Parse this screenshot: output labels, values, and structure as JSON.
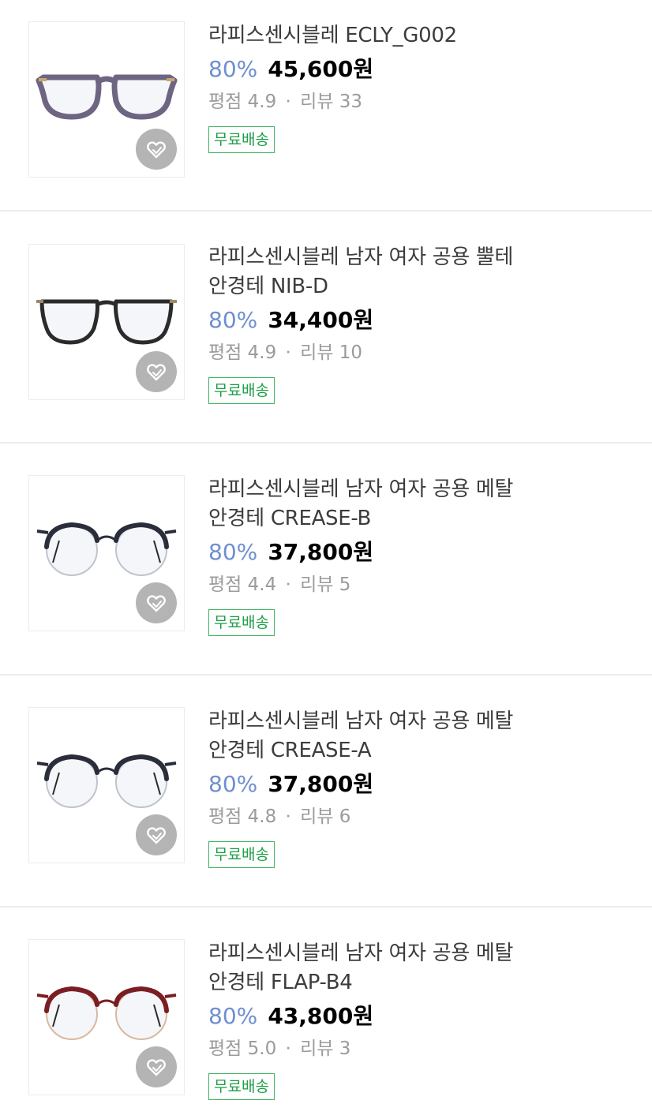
{
  "products": [
    {
      "title_line1": "라피스센시블레 ECLY_G002",
      "title_line2": "",
      "discount": "80%",
      "price": "45,600원",
      "rating_label": "평점",
      "rating": "4.9",
      "review_label": "리뷰",
      "reviews": "33",
      "badge": "무료배송",
      "frame_color": "#6e6583",
      "frame_style": "thick-round"
    },
    {
      "title_line1": "라피스센시블레 남자 여자 공용 뿔테",
      "title_line2": "안경테 NIB-D",
      "discount": "80%",
      "price": "34,400원",
      "rating_label": "평점",
      "rating": "4.9",
      "review_label": "리뷰",
      "reviews": "10",
      "badge": "무료배송",
      "frame_color": "#2b2b2b",
      "frame_style": "thick-square"
    },
    {
      "title_line1": "라피스센시블레 남자 여자 공용 메탈",
      "title_line2": "안경테 CREASE-B",
      "discount": "80%",
      "price": "37,800원",
      "rating_label": "평점",
      "rating": "4.4",
      "review_label": "리뷰",
      "reviews": "5",
      "badge": "무료배송",
      "frame_color": "#2a2d3a",
      "frame_style": "half-rim"
    },
    {
      "title_line1": "라피스센시블레 남자 여자 공용 메탈",
      "title_line2": "안경테 CREASE-A",
      "discount": "80%",
      "price": "37,800원",
      "rating_label": "평점",
      "rating": "4.8",
      "review_label": "리뷰",
      "reviews": "6",
      "badge": "무료배송",
      "frame_color": "#2a2d3a",
      "frame_style": "half-rim"
    },
    {
      "title_line1": "라피스센시블레 남자 여자 공용 메탈",
      "title_line2": "안경테 FLAP-B4",
      "discount": "80%",
      "price": "43,800원",
      "rating_label": "평점",
      "rating": "5.0",
      "review_label": "리뷰",
      "reviews": "3",
      "badge": "무료배송",
      "frame_color": "#7a1e24",
      "frame_style": "half-rim-gold"
    }
  ],
  "colors": {
    "discount": "#6f8fd0",
    "badge_border": "#3fb45f",
    "badge_text": "#1e9e46",
    "like_bg": "#aaaaaa"
  },
  "icons": {
    "like": "heart-outline-icon"
  }
}
